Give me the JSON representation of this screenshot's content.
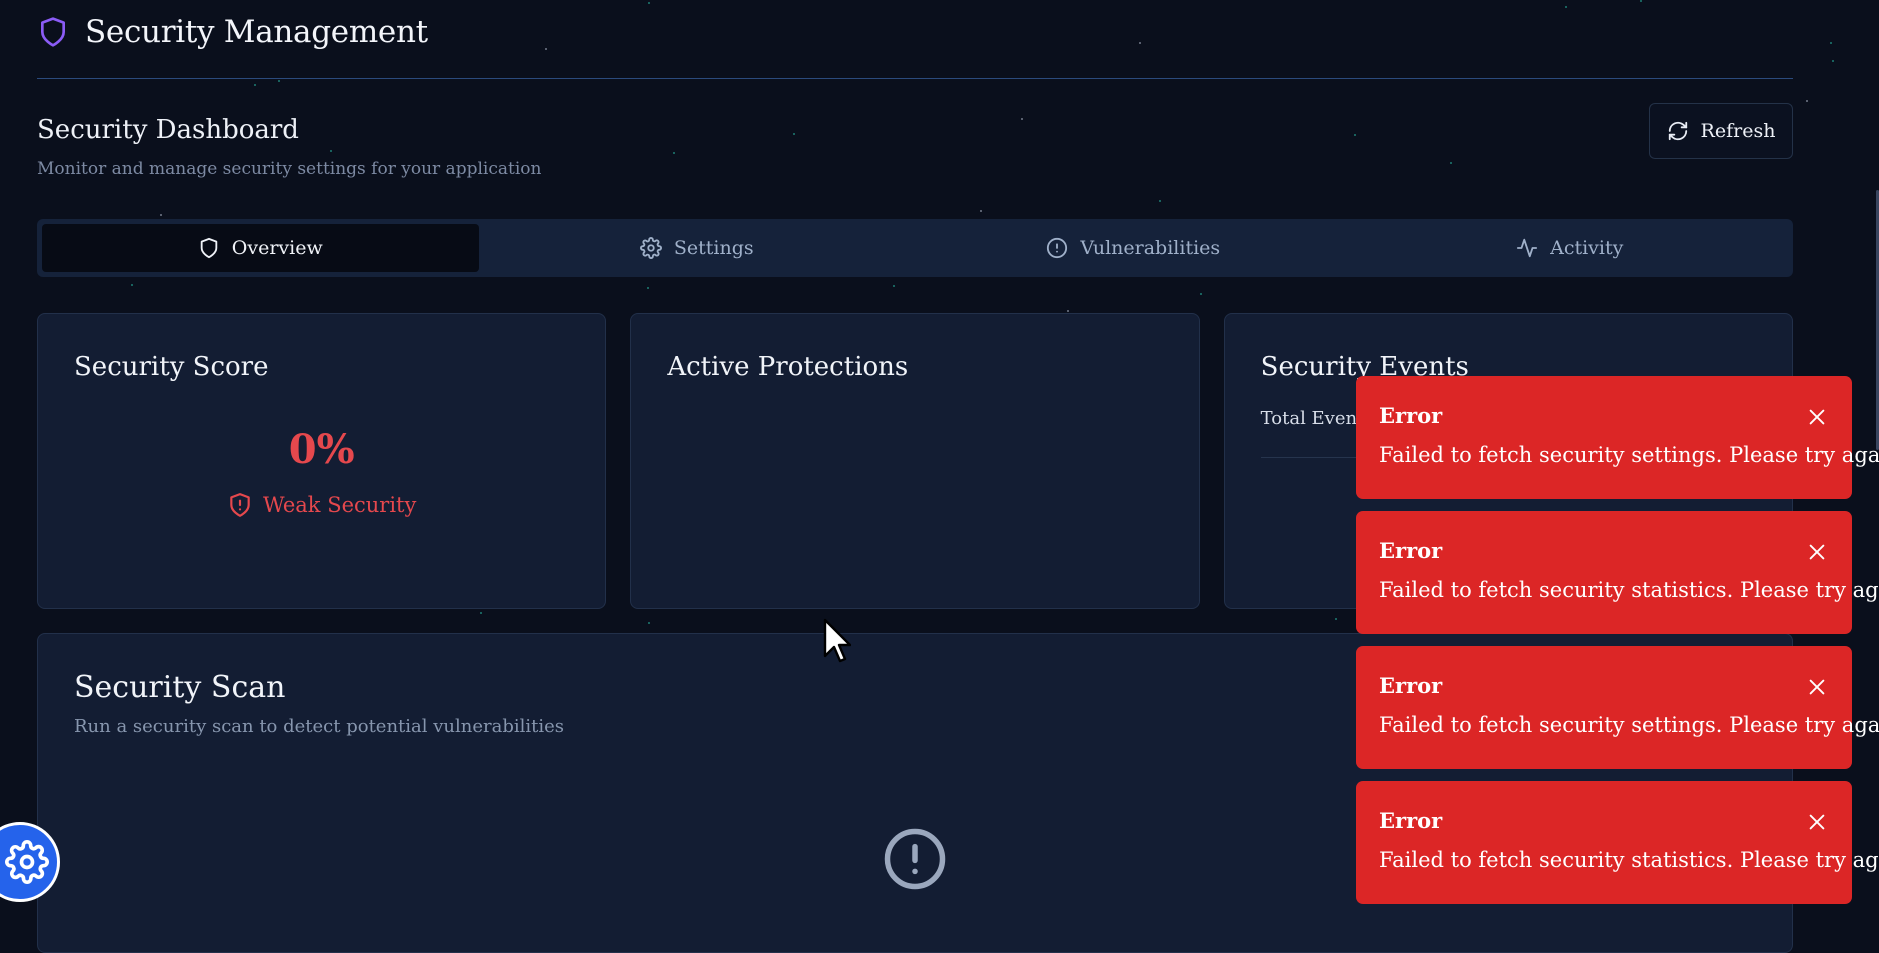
{
  "header": {
    "app_title": "Security Management",
    "icon": "shield-icon"
  },
  "dashboard": {
    "title": "Security Dashboard",
    "subtitle": "Monitor and manage security settings for your application",
    "refresh_label": "Refresh"
  },
  "tabs": [
    {
      "label": "Overview",
      "icon": "shield-icon",
      "active": true
    },
    {
      "label": "Settings",
      "icon": "gear-icon",
      "active": false
    },
    {
      "label": "Vulnerabilities",
      "icon": "alert-circle-icon",
      "active": false
    },
    {
      "label": "Activity",
      "icon": "activity-icon",
      "active": false
    }
  ],
  "cards": {
    "score": {
      "title": "Security Score",
      "value": "0%",
      "status": "Weak Security"
    },
    "protections": {
      "title": "Active Protections"
    },
    "events": {
      "title": "Security Events",
      "total_label": "Total Events"
    }
  },
  "scan": {
    "title": "Security Scan",
    "subtitle": "Run a security scan to detect potential vulnerabilities"
  },
  "toasts": [
    {
      "title": "Error",
      "message": "Failed to fetch security settings. Please try again."
    },
    {
      "title": "Error",
      "message": "Failed to fetch security statistics. Please try again."
    },
    {
      "title": "Error",
      "message": "Failed to fetch security settings. Please try again."
    },
    {
      "title": "Error",
      "message": "Failed to fetch security statistics. Please try again."
    }
  ],
  "colors": {
    "background": "#0a0f1c",
    "card": "#131d33",
    "accent_purple": "#8b5cf6",
    "danger": "#e5484d",
    "toast_red": "#dc2626",
    "fab_blue": "#2563eb"
  }
}
